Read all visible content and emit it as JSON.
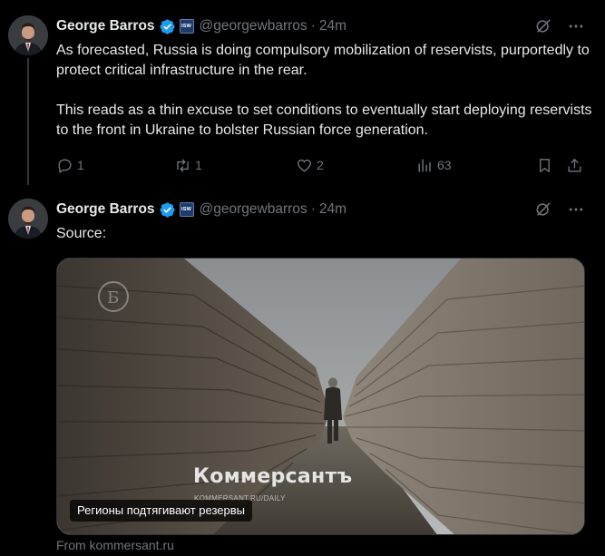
{
  "tweets": [
    {
      "author": {
        "name": "George Barros",
        "handle": "@georgewbarros",
        "affiliation_badge": "ISW",
        "verified_icon": "verified-badge-icon"
      },
      "dot": "·",
      "time": "24m",
      "text": [
        "As forecasted, Russia is doing compulsory mobilization of reservists, purportedly to protect critical infrastructure in the rear.",
        "This reads as a thin excuse to set conditions to eventually start deploying reservists to the front in Ukraine to bolster Russian force generation."
      ],
      "metrics": {
        "replies": "1",
        "reposts": "1",
        "likes": "2",
        "views": "63"
      }
    },
    {
      "author": {
        "name": "George Barros",
        "handle": "@georgewbarros",
        "affiliation_badge": "ISW",
        "verified_icon": "verified-badge-icon"
      },
      "dot": "·",
      "time": "24m",
      "text": [
        "Source:"
      ],
      "card": {
        "brand": "Коммерсантъ",
        "brand_sub": "KOMMERSANT.RU/DAILY",
        "caption": "Регионы подтягивают резервы",
        "from": "From kommersant.ru"
      }
    }
  ],
  "colors": {
    "background": "#000000",
    "text": "#e7e9ea",
    "muted": "#71767b",
    "verified": "#1d9bf0",
    "border": "#2f3336"
  }
}
